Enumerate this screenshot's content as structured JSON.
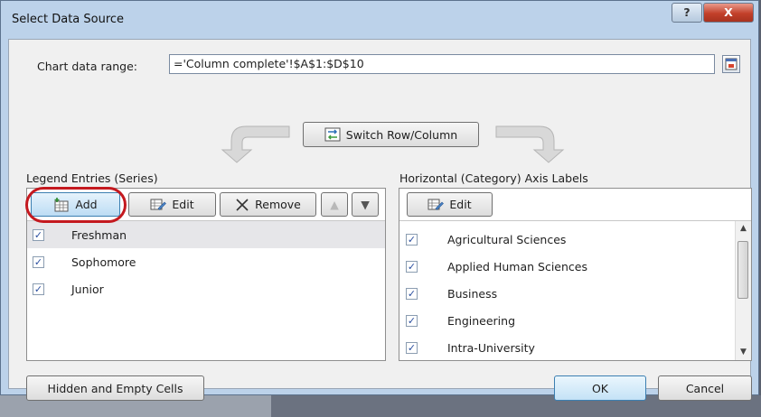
{
  "window": {
    "title": "Select Data Source",
    "help_label": "?",
    "close_label": "X"
  },
  "range": {
    "label": "Chart data range:",
    "value": "='Column complete'!$A$1:$D$10"
  },
  "switch_button": {
    "label": "Switch Row/Column"
  },
  "legend": {
    "heading": "Legend Entries (Series)",
    "add_label": "Add",
    "edit_label": "Edit",
    "remove_label": "Remove",
    "items": [
      {
        "label": "Freshman",
        "checked": true,
        "selected": true
      },
      {
        "label": "Sophomore",
        "checked": true,
        "selected": false
      },
      {
        "label": "Junior",
        "checked": true,
        "selected": false
      }
    ]
  },
  "axis": {
    "heading": "Horizontal (Category) Axis Labels",
    "edit_label": "Edit",
    "items": [
      {
        "label": "Agricultural Sciences",
        "checked": true
      },
      {
        "label": "Applied Human Sciences",
        "checked": true
      },
      {
        "label": "Business",
        "checked": true
      },
      {
        "label": "Engineering",
        "checked": true
      },
      {
        "label": "Intra-University",
        "checked": true
      }
    ]
  },
  "footer": {
    "hidden_cells_label": "Hidden and Empty Cells",
    "ok_label": "OK",
    "cancel_label": "Cancel"
  },
  "icons": [
    "add-series-icon",
    "edit-icon",
    "remove-x-icon",
    "move-up-icon",
    "move-down-icon",
    "switch-icon",
    "collapse-dialog-icon"
  ],
  "colors": {
    "highlight_ring": "#c4191f",
    "titlebar": "#bcd2ea",
    "close_button": "#c2402a"
  }
}
